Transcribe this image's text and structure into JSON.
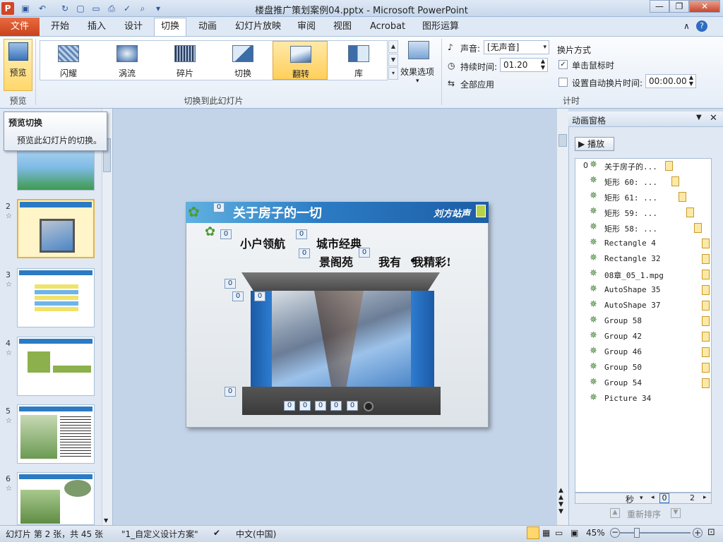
{
  "window": {
    "title": "楼盘推广策划案例04.pptx - Microsoft PowerPoint"
  },
  "tabs": {
    "file": "文件",
    "items": [
      "开始",
      "插入",
      "设计",
      "切换",
      "动画",
      "幻灯片放映",
      "审阅",
      "视图",
      "Acrobat",
      "图形运算"
    ],
    "active": "切换"
  },
  "ribbon": {
    "preview": {
      "label": "预览",
      "group": "预览"
    },
    "transitions": {
      "items": [
        "闪耀",
        "涡流",
        "碎片",
        "切换",
        "翻转",
        "库"
      ],
      "selected": "翻转",
      "group": "切换到此幻灯片"
    },
    "effect_options": "效果选项",
    "timing": {
      "sound_label": "声音:",
      "sound_value": "[无声音]",
      "duration_label": "持续时间:",
      "duration_value": "01.20",
      "apply_all": "全部应用",
      "advance_title": "换片方式",
      "on_click": "单击鼠标时",
      "on_click_checked": true,
      "auto_after": "设置自动换片时间:",
      "auto_after_value": "00:00.00",
      "auto_after_checked": false,
      "group": "计时"
    }
  },
  "tooltip": {
    "title": "预览切换",
    "body": "预览此幻灯片的切换。"
  },
  "slides": {
    "numbers": [
      "2",
      "3",
      "4",
      "5",
      "6"
    ]
  },
  "slide": {
    "title": "关于房子的一切",
    "brand": "刘方站声",
    "line1a": "小户领航",
    "line1b": "城市经典",
    "line2a": "景阁苑",
    "line2b": "我有",
    "line2c": "我精彩!",
    "tag": "0"
  },
  "anim_pane": {
    "title": "动画窗格",
    "play": "播放",
    "items": [
      {
        "num": "0",
        "name": "关于房子的..."
      },
      {
        "name": "矩形 60: ..."
      },
      {
        "name": "矩形 61: ..."
      },
      {
        "name": "矩形 59: ..."
      },
      {
        "name": "矩形 58: ..."
      },
      {
        "name": "Rectangle 4"
      },
      {
        "name": "Rectangle 32"
      },
      {
        "name": "08章_05_1.mpg"
      },
      {
        "name": "AutoShape 35"
      },
      {
        "name": "AutoShape 37"
      },
      {
        "name": "Group 58"
      },
      {
        "name": "Group 42"
      },
      {
        "name": "Group 46"
      },
      {
        "name": "Group 50"
      },
      {
        "name": "Group 54"
      },
      {
        "name": "Picture 34"
      }
    ],
    "seconds": "秒",
    "scale_start": "0",
    "scale_end": "2",
    "reorder": "重新排序"
  },
  "status": {
    "slide_info": "幻灯片 第 2 张，共 45 张",
    "theme": "\"1_自定义设计方案\"",
    "language": "中文(中国)",
    "zoom": "45%"
  }
}
